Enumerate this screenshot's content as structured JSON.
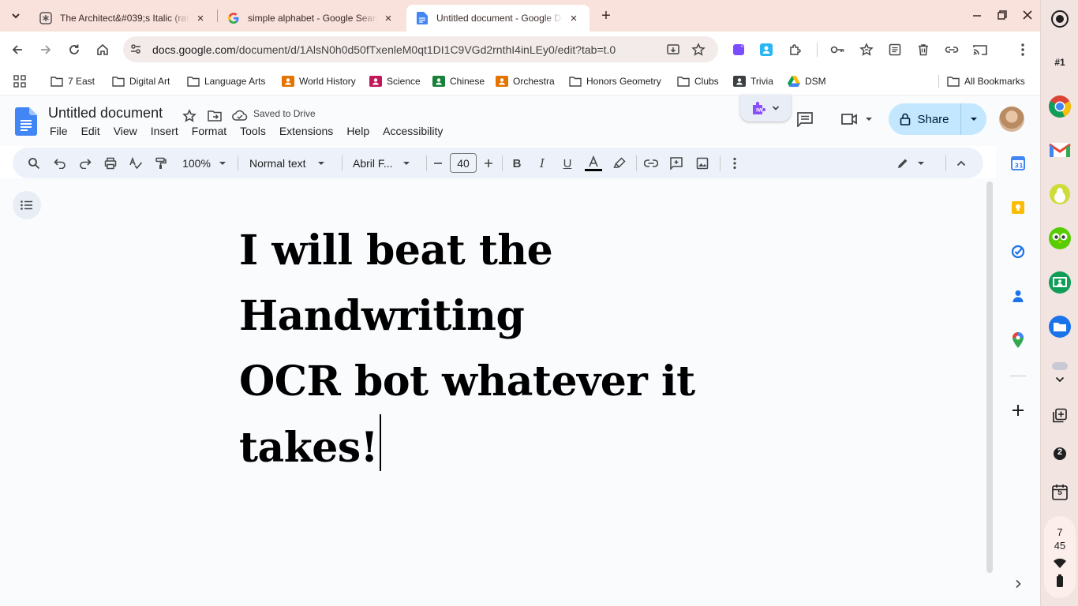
{
  "browser": {
    "tabs": [
      {
        "title": "The Architect&#039;s Italic (rat",
        "favicon": "asterisk-favicon"
      },
      {
        "title": "simple alphabet - Google Searc",
        "favicon": "google-favicon"
      },
      {
        "title": "Untitled document - Google Do",
        "favicon": "docs-favicon",
        "active": true
      }
    ],
    "url_host": "docs.google.com",
    "url_path": "/document/d/1AlsN0h0d50fTxenleM0qt1DI1C9VGd2rnthI4inLEy0/edit?tab=t.0",
    "bookmarks": [
      {
        "label": "7 East",
        "icon": "folder-icon"
      },
      {
        "label": "Digital Art",
        "icon": "folder-icon"
      },
      {
        "label": "Language Arts",
        "icon": "folder-icon"
      },
      {
        "label": "World History",
        "icon": "classroom-icon"
      },
      {
        "label": "Science",
        "icon": "classroom-icon"
      },
      {
        "label": "Chinese",
        "icon": "classroom-icon"
      },
      {
        "label": "Orchestra",
        "icon": "classroom-icon"
      },
      {
        "label": "Honors Geometry",
        "icon": "folder-icon"
      },
      {
        "label": "Clubs",
        "icon": "folder-icon"
      },
      {
        "label": "Trivia",
        "icon": "classroom-icon"
      },
      {
        "label": "DSM",
        "icon": "drive-icon"
      }
    ],
    "all_bookmarks": "All Bookmarks"
  },
  "docs": {
    "title": "Untitled document",
    "saved_status": "Saved to Drive",
    "menu": [
      "File",
      "Edit",
      "View",
      "Insert",
      "Format",
      "Tools",
      "Extensions",
      "Help",
      "Accessibility"
    ],
    "share_label": "Share",
    "toolbar": {
      "zoom": "100%",
      "style": "Normal text",
      "font": "Abril F...",
      "font_size": "40"
    },
    "body_lines": [
      "I will beat the Handwriting",
      "OCR bot whatever it takes!"
    ]
  },
  "shelf": {
    "desk_label": "#1",
    "notifications": "2",
    "calendar_day": "5",
    "time_hour": "7",
    "time_min": "45"
  },
  "colors": {
    "tabstrip": "#f9e1dc",
    "share_button": "#c2e7ff",
    "toolbar_bg": "#edf2fa",
    "docs_blue": "#4285f4"
  }
}
